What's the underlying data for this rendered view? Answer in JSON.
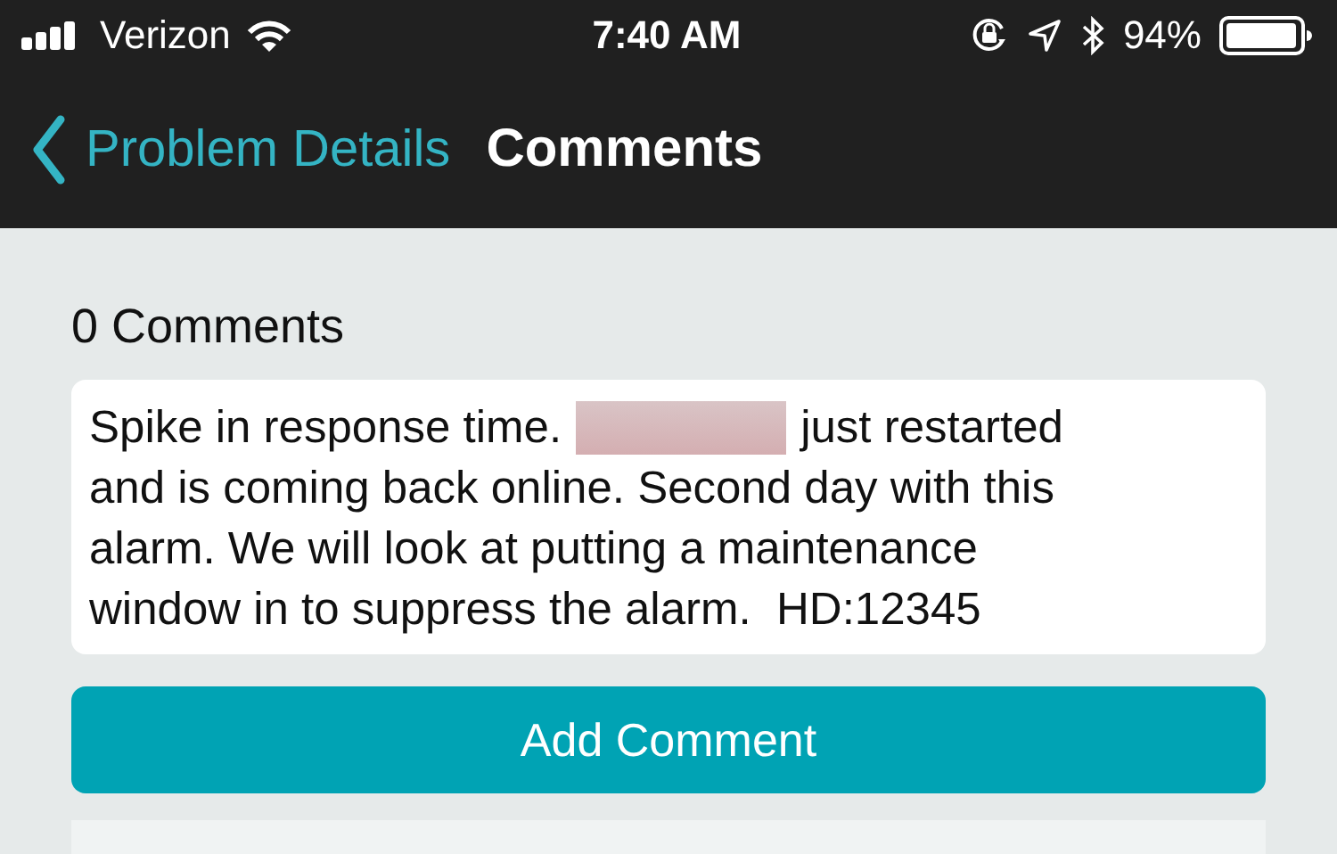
{
  "status_bar": {
    "carrier": "Verizon",
    "time": "7:40 AM",
    "battery": "94%"
  },
  "nav": {
    "back_label": "Problem Details",
    "title": "Comments"
  },
  "comments_count": "0 Comments",
  "comment": {
    "lines": [
      {
        "parts": [
          {
            "kind": "text",
            "text": "Spike in response time."
          },
          {
            "kind": "redacted"
          },
          {
            "kind": "text",
            "text": "just restarted"
          }
        ]
      },
      {
        "parts": [
          {
            "kind": "text",
            "text": "and is coming back online. Second day with this"
          }
        ]
      },
      {
        "parts": [
          {
            "kind": "text",
            "text": "alarm. We will look at putting a maintenance"
          }
        ]
      },
      {
        "parts": [
          {
            "kind": "text",
            "text": "window in to suppress the alarm.  HD:12345"
          }
        ]
      }
    ]
  },
  "add_button": "Add Comment"
}
